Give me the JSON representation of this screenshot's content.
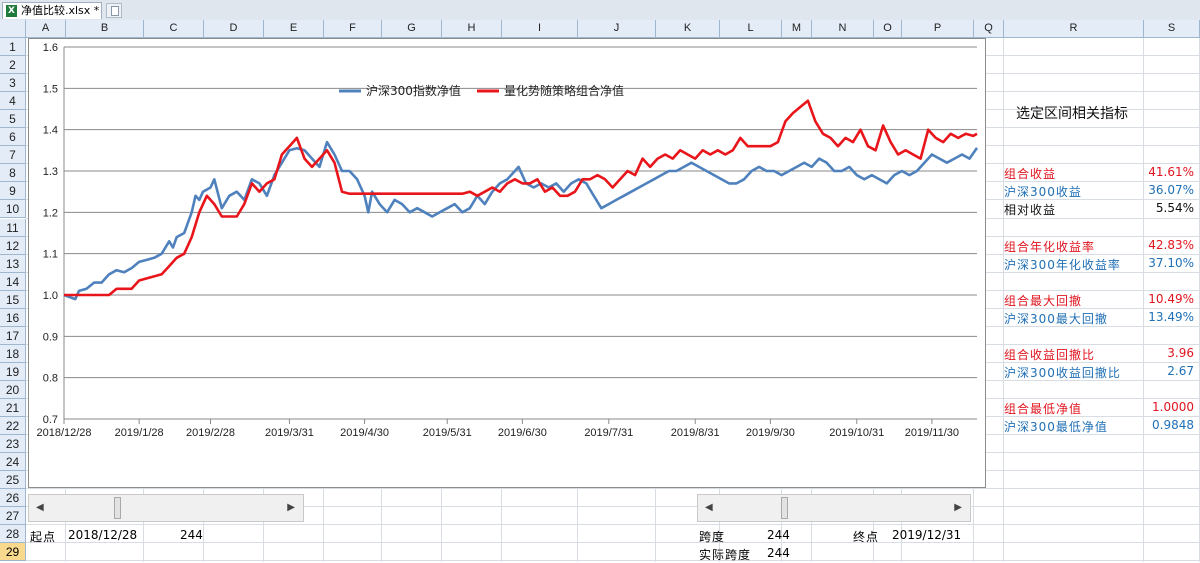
{
  "window": {
    "tab_title": "净值比较.xlsx *"
  },
  "columns": [
    "A",
    "B",
    "C",
    "D",
    "E",
    "F",
    "G",
    "H",
    "I",
    "J",
    "K",
    "L",
    "M",
    "N",
    "O",
    "P",
    "Q",
    "R",
    "S"
  ],
  "rows": [
    "1",
    "2",
    "3",
    "4",
    "5",
    "6",
    "7",
    "8",
    "9",
    "10",
    "11",
    "12",
    "13",
    "14",
    "15",
    "16",
    "17",
    "18",
    "19",
    "20",
    "21",
    "22",
    "23",
    "24",
    "25",
    "26",
    "27",
    "28",
    "29"
  ],
  "selected_row": "29",
  "chart_data": {
    "type": "line",
    "title": "",
    "ylim": [
      0.7,
      1.6
    ],
    "yticks": [
      "1.6",
      "1.5",
      "1.4",
      "1.3",
      "1.2",
      "1.1",
      "1.0",
      "0.9",
      "0.8",
      "0.7"
    ],
    "xticks": [
      "2018/12/28",
      "2019/1/28",
      "2019/2/28",
      "2019/3/31",
      "2019/4/30",
      "2019/5/31",
      "2019/6/30",
      "2019/7/31",
      "2019/8/31",
      "2019/9/30",
      "2019/10/31",
      "2019/11/30"
    ],
    "grid": true,
    "legend": "top",
    "series": [
      {
        "name": "沪深300指数净值",
        "color": "#4f81bd",
        "values": [
          [
            0,
            1.0
          ],
          [
            3,
            0.99
          ],
          [
            4,
            1.01
          ],
          [
            6,
            1.015
          ],
          [
            8,
            1.03
          ],
          [
            10,
            1.03
          ],
          [
            12,
            1.05
          ],
          [
            14,
            1.06
          ],
          [
            16,
            1.055
          ],
          [
            18,
            1.065
          ],
          [
            20,
            1.08
          ],
          [
            22,
            1.085
          ],
          [
            24,
            1.09
          ],
          [
            26,
            1.1
          ],
          [
            28,
            1.13
          ],
          [
            29,
            1.115
          ],
          [
            30,
            1.14
          ],
          [
            32,
            1.15
          ],
          [
            34,
            1.2
          ],
          [
            35,
            1.24
          ],
          [
            36,
            1.23
          ],
          [
            37,
            1.25
          ],
          [
            39,
            1.26
          ],
          [
            40,
            1.28
          ],
          [
            42,
            1.21
          ],
          [
            44,
            1.24
          ],
          [
            46,
            1.25
          ],
          [
            48,
            1.23
          ],
          [
            50,
            1.28
          ],
          [
            52,
            1.27
          ],
          [
            54,
            1.24
          ],
          [
            56,
            1.29
          ],
          [
            58,
            1.32
          ],
          [
            60,
            1.35
          ],
          [
            62,
            1.355
          ],
          [
            64,
            1.35
          ],
          [
            66,
            1.33
          ],
          [
            68,
            1.31
          ],
          [
            70,
            1.37
          ],
          [
            72,
            1.34
          ],
          [
            74,
            1.3
          ],
          [
            76,
            1.3
          ],
          [
            78,
            1.28
          ],
          [
            80,
            1.24
          ],
          [
            81,
            1.2
          ],
          [
            82,
            1.25
          ],
          [
            84,
            1.22
          ],
          [
            86,
            1.2
          ],
          [
            88,
            1.23
          ],
          [
            90,
            1.22
          ],
          [
            92,
            1.2
          ],
          [
            94,
            1.21
          ],
          [
            96,
            1.2
          ],
          [
            98,
            1.19
          ],
          [
            100,
            1.2
          ],
          [
            102,
            1.21
          ],
          [
            104,
            1.22
          ],
          [
            106,
            1.2
          ],
          [
            108,
            1.21
          ],
          [
            110,
            1.24
          ],
          [
            112,
            1.22
          ],
          [
            114,
            1.25
          ],
          [
            116,
            1.27
          ],
          [
            118,
            1.28
          ],
          [
            120,
            1.3
          ],
          [
            121,
            1.31
          ],
          [
            123,
            1.27
          ],
          [
            125,
            1.26
          ],
          [
            127,
            1.27
          ],
          [
            129,
            1.26
          ],
          [
            131,
            1.27
          ],
          [
            133,
            1.25
          ],
          [
            135,
            1.27
          ],
          [
            137,
            1.28
          ],
          [
            139,
            1.27
          ],
          [
            141,
            1.24
          ],
          [
            143,
            1.21
          ],
          [
            145,
            1.22
          ],
          [
            147,
            1.23
          ],
          [
            149,
            1.24
          ],
          [
            151,
            1.25
          ],
          [
            153,
            1.26
          ],
          [
            155,
            1.27
          ],
          [
            157,
            1.28
          ],
          [
            159,
            1.29
          ],
          [
            161,
            1.3
          ],
          [
            163,
            1.3
          ],
          [
            165,
            1.31
          ],
          [
            167,
            1.32
          ],
          [
            169,
            1.31
          ],
          [
            171,
            1.3
          ],
          [
            173,
            1.29
          ],
          [
            175,
            1.28
          ],
          [
            177,
            1.27
          ],
          [
            179,
            1.27
          ],
          [
            181,
            1.28
          ],
          [
            183,
            1.3
          ],
          [
            185,
            1.31
          ],
          [
            187,
            1.3
          ],
          [
            189,
            1.3
          ],
          [
            191,
            1.29
          ],
          [
            193,
            1.3
          ],
          [
            195,
            1.31
          ],
          [
            197,
            1.32
          ],
          [
            199,
            1.31
          ],
          [
            201,
            1.33
          ],
          [
            203,
            1.32
          ],
          [
            205,
            1.3
          ],
          [
            207,
            1.3
          ],
          [
            209,
            1.31
          ],
          [
            211,
            1.29
          ],
          [
            213,
            1.28
          ],
          [
            215,
            1.29
          ],
          [
            217,
            1.28
          ],
          [
            219,
            1.27
          ],
          [
            221,
            1.29
          ],
          [
            223,
            1.3
          ],
          [
            225,
            1.29
          ],
          [
            227,
            1.3
          ],
          [
            229,
            1.32
          ],
          [
            231,
            1.34
          ],
          [
            233,
            1.33
          ],
          [
            235,
            1.32
          ],
          [
            237,
            1.33
          ],
          [
            239,
            1.34
          ],
          [
            241,
            1.33
          ],
          [
            243,
            1.356
          ]
        ]
      },
      {
        "name": "量化势随策略组合净值",
        "color": "#e8151b",
        "values": [
          [
            0,
            1.0
          ],
          [
            12,
            1.0
          ],
          [
            14,
            1.015
          ],
          [
            18,
            1.015
          ],
          [
            20,
            1.035
          ],
          [
            26,
            1.05
          ],
          [
            28,
            1.07
          ],
          [
            30,
            1.09
          ],
          [
            32,
            1.1
          ],
          [
            34,
            1.14
          ],
          [
            36,
            1.2
          ],
          [
            38,
            1.24
          ],
          [
            40,
            1.22
          ],
          [
            42,
            1.19
          ],
          [
            46,
            1.19
          ],
          [
            48,
            1.22
          ],
          [
            50,
            1.27
          ],
          [
            52,
            1.25
          ],
          [
            54,
            1.27
          ],
          [
            56,
            1.28
          ],
          [
            58,
            1.34
          ],
          [
            60,
            1.36
          ],
          [
            62,
            1.38
          ],
          [
            64,
            1.33
          ],
          [
            66,
            1.31
          ],
          [
            68,
            1.33
          ],
          [
            70,
            1.35
          ],
          [
            72,
            1.32
          ],
          [
            74,
            1.25
          ],
          [
            76,
            1.245
          ],
          [
            80,
            1.245
          ],
          [
            90,
            1.245
          ],
          [
            100,
            1.245
          ],
          [
            106,
            1.245
          ],
          [
            108,
            1.25
          ],
          [
            110,
            1.24
          ],
          [
            112,
            1.25
          ],
          [
            114,
            1.26
          ],
          [
            116,
            1.25
          ],
          [
            118,
            1.27
          ],
          [
            120,
            1.28
          ],
          [
            122,
            1.27
          ],
          [
            124,
            1.27
          ],
          [
            126,
            1.28
          ],
          [
            128,
            1.25
          ],
          [
            130,
            1.26
          ],
          [
            132,
            1.24
          ],
          [
            134,
            1.24
          ],
          [
            136,
            1.25
          ],
          [
            138,
            1.28
          ],
          [
            140,
            1.28
          ],
          [
            142,
            1.29
          ],
          [
            144,
            1.28
          ],
          [
            146,
            1.26
          ],
          [
            148,
            1.28
          ],
          [
            150,
            1.3
          ],
          [
            152,
            1.29
          ],
          [
            154,
            1.33
          ],
          [
            156,
            1.31
          ],
          [
            158,
            1.33
          ],
          [
            160,
            1.34
          ],
          [
            162,
            1.33
          ],
          [
            164,
            1.35
          ],
          [
            166,
            1.34
          ],
          [
            168,
            1.33
          ],
          [
            170,
            1.35
          ],
          [
            172,
            1.34
          ],
          [
            174,
            1.35
          ],
          [
            176,
            1.34
          ],
          [
            178,
            1.35
          ],
          [
            180,
            1.38
          ],
          [
            182,
            1.36
          ],
          [
            186,
            1.36
          ],
          [
            188,
            1.36
          ],
          [
            190,
            1.37
          ],
          [
            192,
            1.42
          ],
          [
            194,
            1.44
          ],
          [
            196,
            1.455
          ],
          [
            198,
            1.47
          ],
          [
            200,
            1.42
          ],
          [
            202,
            1.39
          ],
          [
            204,
            1.38
          ],
          [
            206,
            1.36
          ],
          [
            208,
            1.38
          ],
          [
            210,
            1.37
          ],
          [
            212,
            1.4
          ],
          [
            214,
            1.36
          ],
          [
            216,
            1.35
          ],
          [
            218,
            1.41
          ],
          [
            220,
            1.37
          ],
          [
            222,
            1.34
          ],
          [
            224,
            1.35
          ],
          [
            226,
            1.34
          ],
          [
            228,
            1.33
          ],
          [
            230,
            1.4
          ],
          [
            232,
            1.38
          ],
          [
            234,
            1.37
          ],
          [
            236,
            1.39
          ],
          [
            238,
            1.38
          ],
          [
            240,
            1.39
          ],
          [
            242,
            1.385
          ],
          [
            243,
            1.39
          ]
        ]
      }
    ]
  },
  "metrics": {
    "title": "选定区间相关指标",
    "items": [
      {
        "label": "组合收益",
        "value": "41.61%",
        "color": "red",
        "row": 8
      },
      {
        "label": "沪深300收益",
        "value": "36.07%",
        "color": "blue",
        "row": 9
      },
      {
        "label": "相对收益",
        "value": "5.54%",
        "color": "black",
        "row": 10
      },
      {
        "label": "组合年化收益率",
        "value": "42.83%",
        "color": "red",
        "row": 12
      },
      {
        "label": "沪深300年化收益率",
        "value": "37.10%",
        "color": "blue",
        "row": 13
      },
      {
        "label": "组合最大回撤",
        "value": "10.49%",
        "color": "red",
        "row": 15
      },
      {
        "label": "沪深300最大回撤",
        "value": "13.49%",
        "color": "blue",
        "row": 16
      },
      {
        "label": "组合收益回撤比",
        "value": "3.96",
        "color": "red",
        "row": 18
      },
      {
        "label": "沪深300收益回撤比",
        "value": "2.67",
        "color": "blue",
        "row": 19
      },
      {
        "label": "组合最低净值",
        "value": "1.0000",
        "color": "red",
        "row": 21
      },
      {
        "label": "沪深300最低净值",
        "value": "0.9848",
        "color": "blue",
        "row": 22
      }
    ]
  },
  "cells": {
    "start_label": "起点",
    "start_date": "2018/12/28",
    "start_value": "244",
    "span_label": "跨度",
    "span_value": "244",
    "end_label": "终点",
    "end_date": "2019/12/31",
    "actual_span_label": "实际跨度",
    "actual_span_value": "244"
  }
}
